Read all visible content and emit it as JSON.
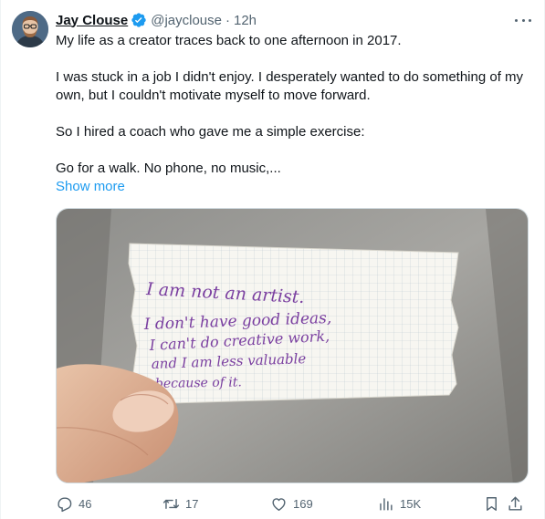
{
  "author": {
    "name": "Jay Clouse",
    "handle": "@jayclouse",
    "separator": "·",
    "time": "12h"
  },
  "tweet": {
    "paragraphs": [
      "My life as a creator traces back to one afternoon in 2017.",
      "I was stuck in a job I didn't enjoy. I desperately wanted to do something of my own, but I couldn't motivate myself to move forward.",
      "So I hired a coach who gave me a simple exercise:",
      "Go for a walk. No phone, no music,..."
    ],
    "show_more_label": "Show more"
  },
  "media": {
    "note_lines": [
      "I am not an artist.",
      "I don't have good ideas,",
      "I can't do creative work,",
      "and I am less valuable",
      "because of it."
    ]
  },
  "actions": {
    "replies": "46",
    "reposts": "17",
    "likes": "169",
    "views": "15K"
  },
  "colors": {
    "accent": "#1d9bf0",
    "muted": "#536471",
    "ink": "#7a3fa0"
  }
}
